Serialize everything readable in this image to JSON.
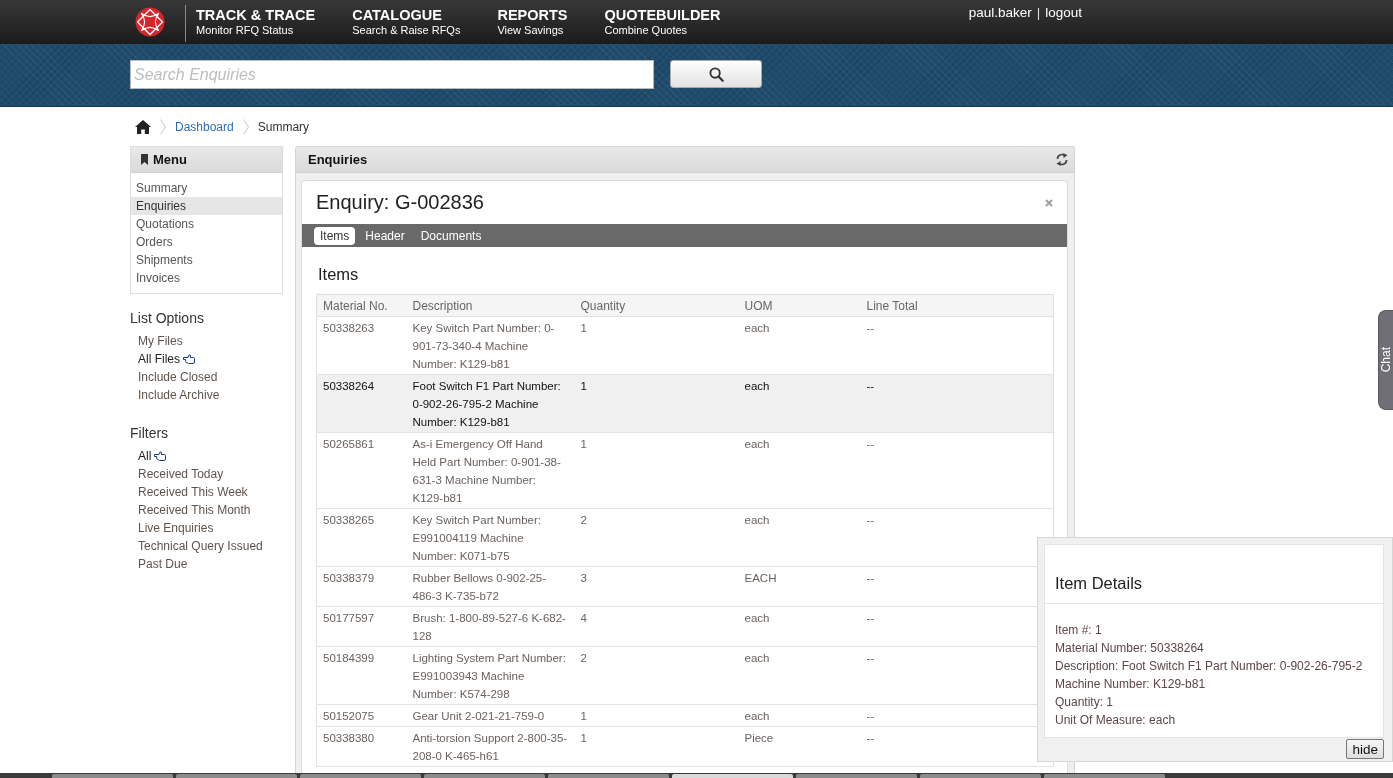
{
  "header": {
    "nav": [
      {
        "title": "TRACK & TRACE",
        "subtitle": "Monitor RFQ Status"
      },
      {
        "title": "CATALOGUE",
        "subtitle": "Search & Raise RFQs"
      },
      {
        "title": "REPORTS",
        "subtitle": "View Savings"
      },
      {
        "title": "QUOTEBUILDER",
        "subtitle": "Combine Quotes"
      }
    ],
    "user": {
      "name": "paul.baker",
      "separator": "|",
      "logout": "logout"
    }
  },
  "search": {
    "placeholder": "Search Enquiries"
  },
  "breadcrumb": [
    {
      "label": "Dashboard",
      "current": false
    },
    {
      "label": "Summary",
      "current": true
    }
  ],
  "sidebar": {
    "menu": {
      "title": "Menu",
      "items": [
        {
          "label": "Summary",
          "selected": false
        },
        {
          "label": "Enquiries",
          "selected": true
        },
        {
          "label": "Quotations",
          "selected": false
        },
        {
          "label": "Orders",
          "selected": false
        },
        {
          "label": "Shipments",
          "selected": false
        },
        {
          "label": "Invoices",
          "selected": false
        }
      ]
    },
    "list_options": {
      "title": "List Options",
      "items": [
        {
          "label": "My Files",
          "selected": false
        },
        {
          "label": "All Files",
          "selected": true
        },
        {
          "label": "Include Closed",
          "selected": false
        },
        {
          "label": "Include Archive",
          "selected": false
        }
      ]
    },
    "filters": {
      "title": "Filters",
      "items": [
        {
          "label": "All",
          "selected": true
        },
        {
          "label": "Received Today",
          "selected": false
        },
        {
          "label": "Received This Week",
          "selected": false
        },
        {
          "label": "Received This Month",
          "selected": false
        },
        {
          "label": "Live Enquiries",
          "selected": false
        },
        {
          "label": "Technical Query Issued",
          "selected": false
        },
        {
          "label": "Past Due",
          "selected": false
        }
      ]
    }
  },
  "panel": {
    "title": "Enquiries",
    "enquiry": {
      "title": "Enquiry: G-002836",
      "tabs": [
        {
          "label": "Items",
          "selected": true
        },
        {
          "label": "Header",
          "selected": false
        },
        {
          "label": "Documents",
          "selected": false
        }
      ],
      "section_title": "Items",
      "table": {
        "columns": [
          "Material No.",
          "Description",
          "Quantity",
          "UOM",
          "Line Total"
        ],
        "rows": [
          {
            "cells": [
              "50338263",
              "Key Switch Part Number: 0-901-73-340-4 Machine Number: K129-b81",
              "1",
              "each",
              "--"
            ],
            "selected": false
          },
          {
            "cells": [
              "50338264",
              "Foot Switch F1 Part Number: 0-902-26-795-2 Machine Number: K129-b81",
              "1",
              "each",
              "--"
            ],
            "selected": true
          },
          {
            "cells": [
              "50265861",
              "As-i Emergency Off Hand Held Part Number: 0-901-38-631-3 Machine Number: K129-b81",
              "1",
              "each",
              "--"
            ],
            "selected": false
          },
          {
            "cells": [
              "50338265",
              "Key Switch Part Number: E991004119 Machine Number: K071-b75",
              "2",
              "each",
              "--"
            ],
            "selected": false
          },
          {
            "cells": [
              "50338379",
              "Rubber Bellows 0-902-25-486-3 K-735-b72",
              "3",
              "EACH",
              "--"
            ],
            "selected": false
          },
          {
            "cells": [
              "50177597",
              "Brush: 1-800-89-527-6 K-682-128",
              "4",
              "each",
              "--"
            ],
            "selected": false
          },
          {
            "cells": [
              "50184399",
              "Lighting System Part Number: E991003943 Machine Number: K574-298",
              "2",
              "each",
              "--"
            ],
            "selected": false
          },
          {
            "cells": [
              "50152075",
              "Gear Unit 2-021-21-759-0",
              "1",
              "each",
              "--"
            ],
            "selected": false
          },
          {
            "cells": [
              "50338380",
              "Anti-torsion Support 2-800-35-208-0 K-465-h61",
              "1",
              "Piece",
              "--"
            ],
            "selected": false
          }
        ]
      }
    }
  },
  "item_details": {
    "title": "Item Details",
    "lines": [
      "Item #: 1",
      "Material Number: 50338264",
      "Description: Foot Switch F1 Part Number: 0-902-26-795-2",
      "Machine Number: K129-b81",
      "Quantity: 1",
      "Unit Of Measure: each"
    ],
    "hide_button": "hide"
  },
  "chat": {
    "label": "Chat"
  },
  "taskbar": {
    "tabs": [
      {
        "selected": false
      },
      {
        "selected": false
      },
      {
        "selected": false
      },
      {
        "selected": false
      },
      {
        "selected": false
      },
      {
        "selected": true
      },
      {
        "selected": false
      },
      {
        "selected": false
      },
      {
        "selected": false
      }
    ]
  }
}
